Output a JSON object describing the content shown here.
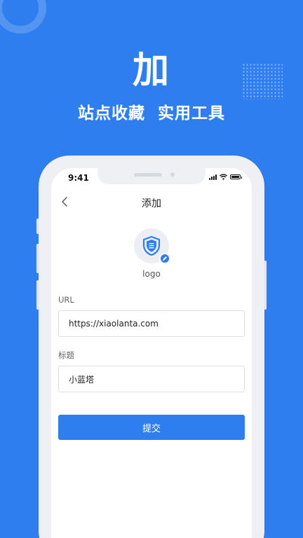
{
  "promo": {
    "headline": "加",
    "tagline": "站点收藏  实用工具"
  },
  "status_bar": {
    "time": "9:41"
  },
  "nav": {
    "title": "添加",
    "back_icon": "chevron-left-icon"
  },
  "logo": {
    "label": "logo",
    "icon": "shield-icon",
    "badge_icon": "pencil-icon"
  },
  "form": {
    "url_label": "URL",
    "url_value": "https://xiaolanta.com",
    "title_label": "标题",
    "title_value": "小蓝塔",
    "submit_label": "提交"
  },
  "colors": {
    "primary": "#2f7ef0",
    "background": "#2f7ef0",
    "screen": "#ffffff"
  }
}
